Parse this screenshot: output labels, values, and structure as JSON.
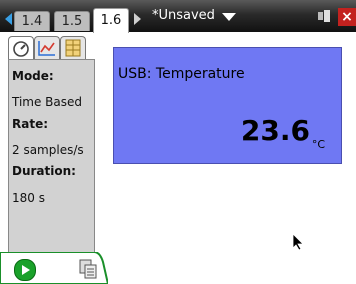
{
  "tabs": [
    {
      "label": "1.4"
    },
    {
      "label": "1.5"
    },
    {
      "label": "1.6",
      "active": true
    }
  ],
  "document": {
    "title": "*Unsaved"
  },
  "left_panel": {
    "mode_label": "Mode:",
    "mode_value": "Time Based",
    "rate_label": "Rate:",
    "rate_value": "2 samples/s",
    "duration_label": "Duration:",
    "duration_value": "180 s"
  },
  "meter": {
    "label": "USB: Temperature",
    "value": "23.6",
    "unit": "°C"
  },
  "colors": {
    "meter_bg": "#6f78f3",
    "play": "#1aa12a",
    "close": "#c3221f",
    "accent": "#39a0e6"
  },
  "icons": [
    "meter-icon",
    "graph-icon",
    "table-icon",
    "play-icon",
    "copy-icon",
    "battery-icon",
    "close-icon",
    "pointer-icon"
  ]
}
